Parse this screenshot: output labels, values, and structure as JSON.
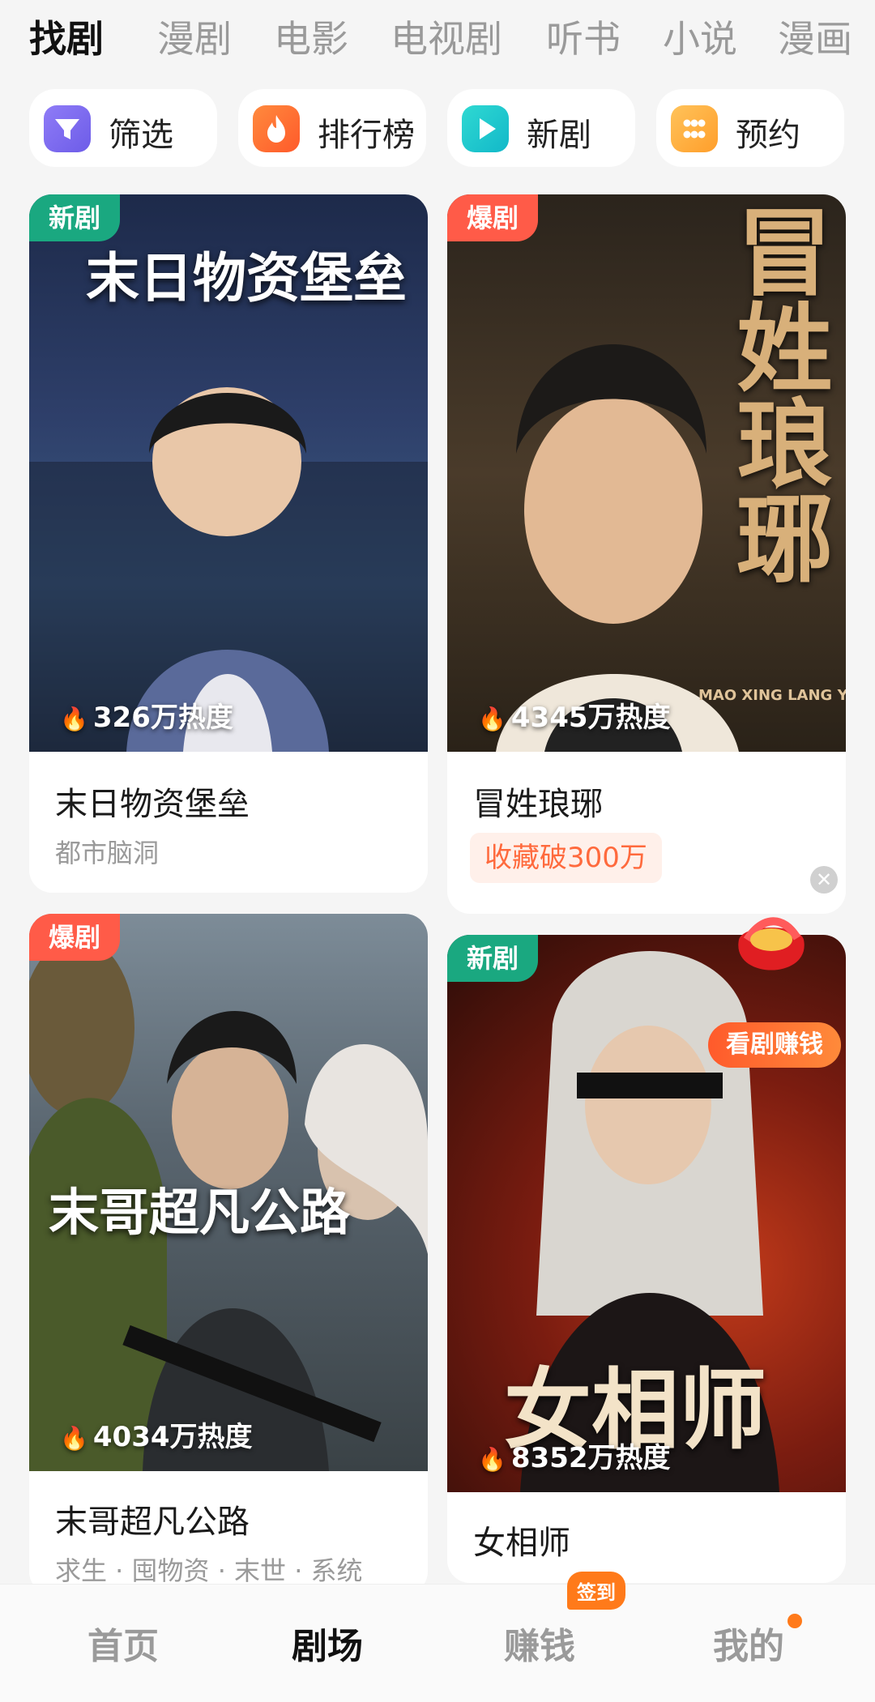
{
  "tabs": [
    "找剧",
    "漫剧",
    "电影",
    "电视剧",
    "听书",
    "小说",
    "漫画"
  ],
  "quick_buttons": [
    {
      "label": "筛选",
      "icon": "filter-icon"
    },
    {
      "label": "排行榜",
      "icon": "flame-icon"
    },
    {
      "label": "新剧",
      "icon": "play-icon"
    },
    {
      "label": "预约",
      "icon": "grid-icon"
    }
  ],
  "cards": [
    {
      "badge": "新剧",
      "poster_title": "末日物资堡垒",
      "heat": "326万热度",
      "title": "末日物资堡垒",
      "sub": "都市脑洞"
    },
    {
      "badge": "爆剧",
      "poster_title": "冒姓琅琊",
      "poster_small": "MAO XING LANG YA",
      "heat": "4345万热度",
      "title": "冒姓琅琊",
      "tag": "收藏破300万"
    },
    {
      "badge": "爆剧",
      "poster_title": "末哥超凡公路",
      "heat": "4034万热度",
      "title": "末哥超凡公路",
      "sub": "求生 · 囤物资 · 末世 · 系统"
    },
    {
      "badge": "新剧",
      "poster_title": "女相师",
      "heat": "8352万热度",
      "title": "女相师",
      "earn": "看剧赚钱"
    }
  ],
  "bottom_nav": [
    "首页",
    "剧场",
    "赚钱",
    "我的"
  ],
  "nav_badge": "签到"
}
